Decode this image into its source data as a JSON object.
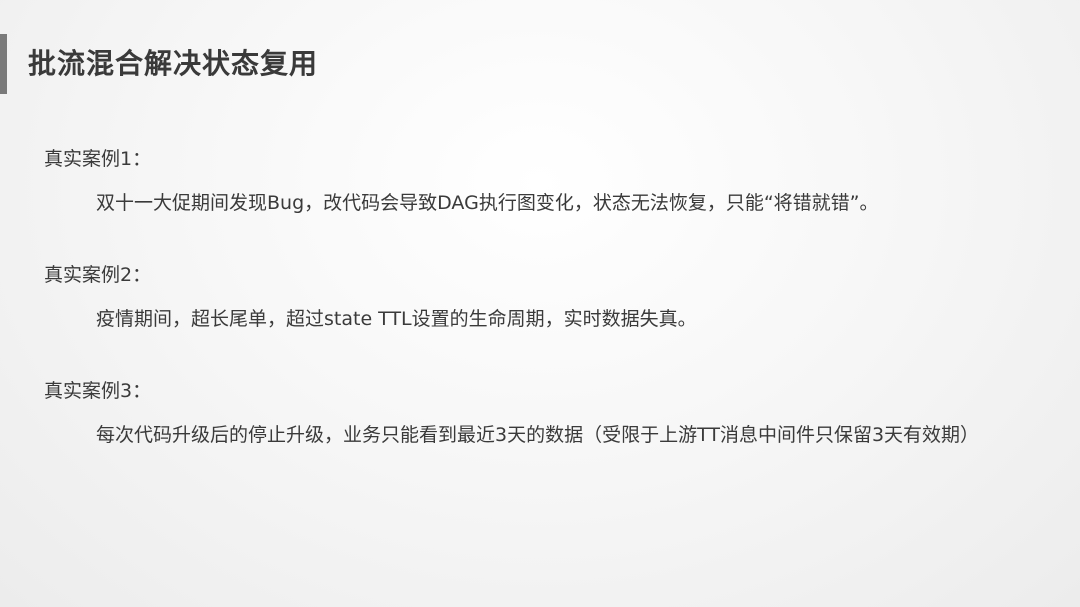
{
  "slide": {
    "title": "批流混合解决状态复用",
    "cases": [
      {
        "heading": "真实案例1：",
        "body": "双十一大促期间发现Bug，改代码会导致DAG执行图变化，状态无法恢复，只能“将错就错”。"
      },
      {
        "heading": "真实案例2：",
        "body": "疫情期间，超长尾单，超过state TTL设置的生命周期，实时数据失真。"
      },
      {
        "heading": "真实案例3：",
        "body": "每次代码升级后的停止升级，业务只能看到最近3天的数据（受限于上游TT消息中间件只保留3天有效期）"
      }
    ]
  },
  "colors": {
    "text": "#3a3a3a",
    "accent_bar": "#7a7a7a",
    "background": "#f4f4f4"
  }
}
